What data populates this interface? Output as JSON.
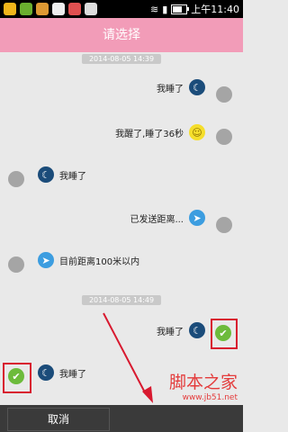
{
  "status_bar": {
    "time": "上午11:40"
  },
  "title": "请选择",
  "timestamps": [
    "2014-08-05 14:39",
    "2014-08-05 14:49"
  ],
  "messages": [
    {
      "text": "我睡了",
      "icon": "moon-icon",
      "side": "right"
    },
    {
      "text": "我醒了,睡了36秒",
      "icon": "sun-icon",
      "side": "right"
    },
    {
      "text": "我睡了",
      "icon": "moon-icon",
      "side": "left"
    },
    {
      "text": "已发送距离...",
      "icon": "location-arrow-icon",
      "side": "right"
    },
    {
      "text": "目前距离100米以内",
      "icon": "location-arrow-icon",
      "side": "left"
    },
    {
      "text": "我睡了",
      "icon": "moon-icon",
      "side": "right",
      "selected": true
    },
    {
      "text": "我睡了",
      "icon": "moon-icon",
      "side": "left",
      "selected": true
    }
  ],
  "bottom": {
    "cancel_label": "取消"
  },
  "watermark": {
    "title": "脚本之家",
    "url": "www.jb51.net"
  },
  "colors": {
    "title_bar": "#f29cb8",
    "selected": "#6dbb3b",
    "highlight": "#d8192f"
  }
}
